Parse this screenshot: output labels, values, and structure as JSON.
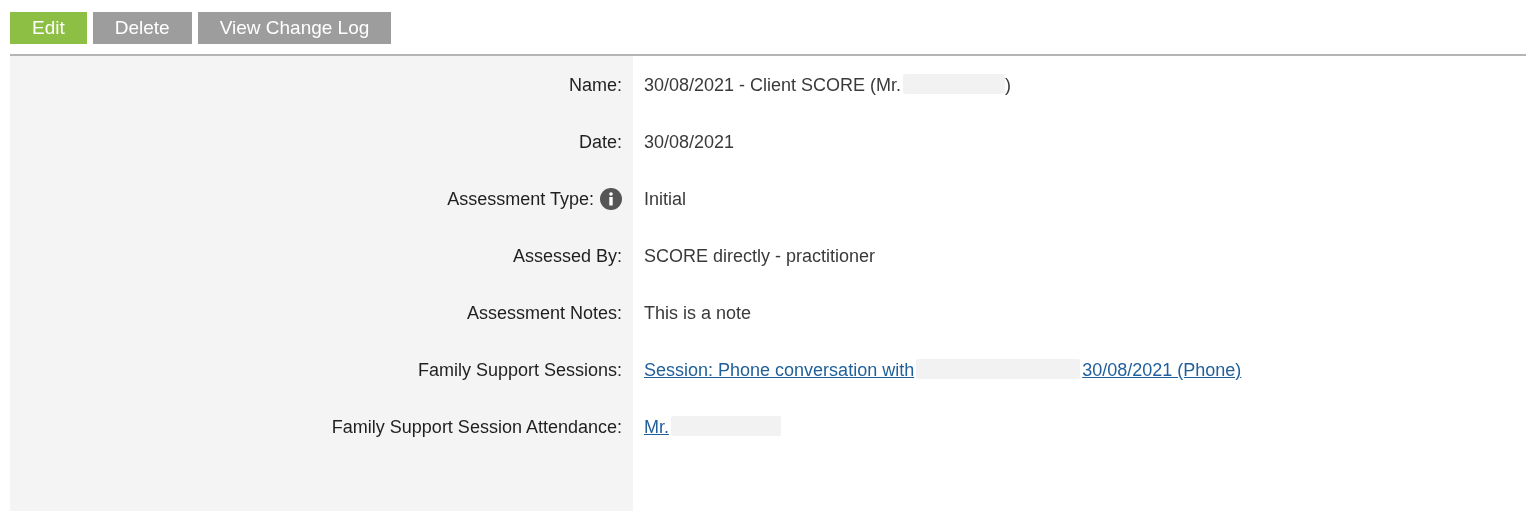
{
  "toolbar": [
    {
      "label": "Edit",
      "kind": "primary"
    },
    {
      "label": "Delete",
      "kind": "secondary"
    },
    {
      "label": "View Change Log",
      "kind": "secondary"
    }
  ],
  "fields": [
    {
      "label": "Name:",
      "kind": "text",
      "value": "30/08/2021 - Client SCORE (Mr.",
      "redacted": true,
      "value_after": ")"
    },
    {
      "label": "Date:",
      "kind": "text",
      "value": "30/08/2021"
    },
    {
      "label": "Assessment Type:",
      "kind": "text",
      "info": true,
      "value": "Initial"
    },
    {
      "label": "Assessed By:",
      "kind": "text",
      "value": "SCORE directly - practitioner"
    },
    {
      "label": "Assessment Notes:",
      "kind": "text",
      "value": "This is a note"
    },
    {
      "label": "Family Support Sessions:",
      "kind": "link",
      "value": "Session: Phone conversation with",
      "redacted": true,
      "value_after": "30/08/2021 (Phone)"
    },
    {
      "label": "Family Support Session Attendance:",
      "kind": "link",
      "value": "Mr.",
      "redacted": true
    }
  ]
}
